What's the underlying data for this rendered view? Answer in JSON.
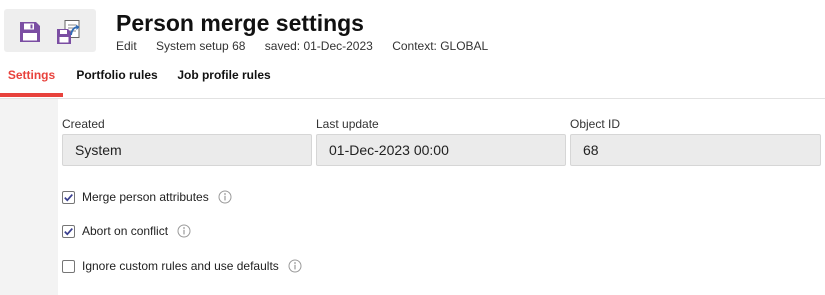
{
  "toolbar": {
    "save_icon": "save-icon",
    "save_as_icon": "save-as-icon",
    "accent_color": "#7b4ea3",
    "secondary_color": "#2f6bb5"
  },
  "header": {
    "title": "Person merge settings",
    "meta": {
      "mode": "Edit",
      "setup": "System setup 68",
      "saved": "saved: 01-Dec-2023",
      "context": "Context: GLOBAL"
    }
  },
  "tabs": [
    {
      "label": "Settings",
      "active": true
    },
    {
      "label": "Portfolio rules",
      "active": false
    },
    {
      "label": "Job profile rules",
      "active": false
    }
  ],
  "active_tab_color": "#e8423c",
  "fields": {
    "created": {
      "label": "Created",
      "value": "System"
    },
    "last_update": {
      "label": "Last update",
      "value": "01-Dec-2023 00:00"
    },
    "object_id": {
      "label": "Object ID",
      "value": "68"
    }
  },
  "options": [
    {
      "label": "Merge person attributes",
      "checked": true,
      "info_icon": "info-icon"
    },
    {
      "label": "Abort on conflict",
      "checked": true,
      "info_icon": "info-icon"
    },
    {
      "label": "Ignore custom rules and use defaults",
      "checked": false,
      "info_icon": "info-icon"
    }
  ]
}
